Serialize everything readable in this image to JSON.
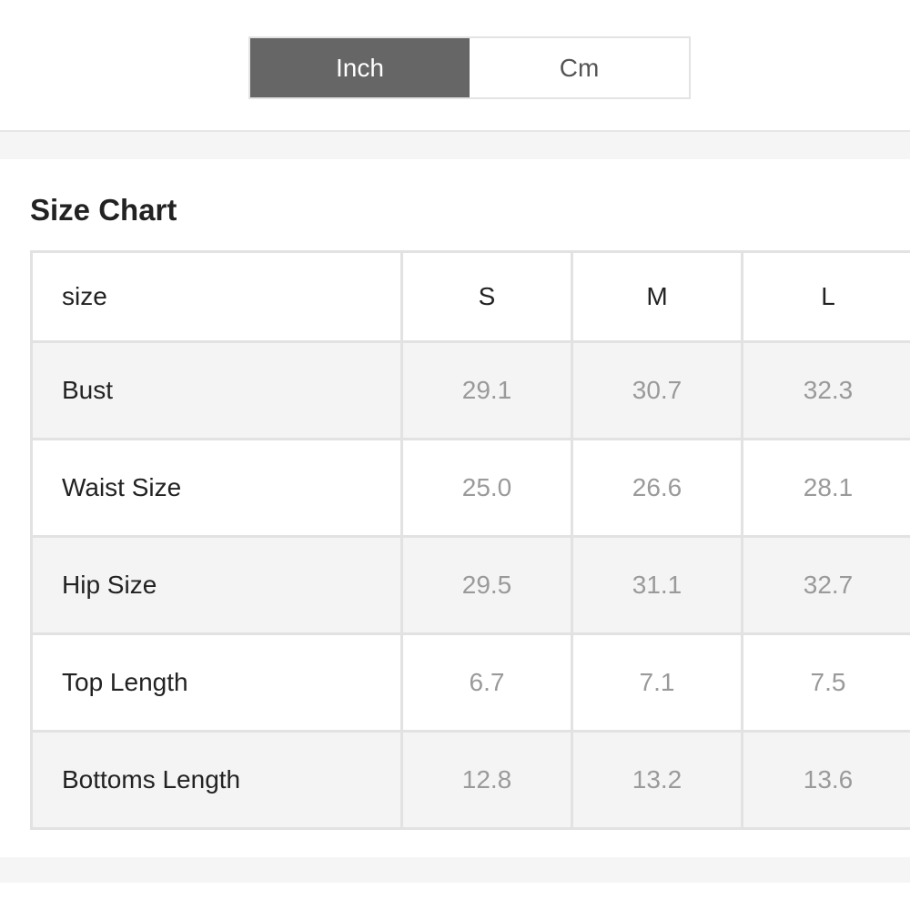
{
  "unit_toggle": {
    "options": [
      "Inch",
      "Cm"
    ],
    "selected": "Inch"
  },
  "title": "Size Chart",
  "table": {
    "columns": [
      "size",
      "S",
      "M",
      "L"
    ],
    "rows": [
      {
        "label": "Bust",
        "values": [
          "29.1",
          "30.7",
          "32.3"
        ]
      },
      {
        "label": "Waist Size",
        "values": [
          "25.0",
          "26.6",
          "28.1"
        ]
      },
      {
        "label": "Hip Size",
        "values": [
          "29.5",
          "31.1",
          "32.7"
        ]
      },
      {
        "label": "Top Length",
        "values": [
          "6.7",
          "7.1",
          "7.5"
        ]
      },
      {
        "label": "Bottoms Length",
        "values": [
          "12.8",
          "13.2",
          "13.6"
        ]
      }
    ]
  },
  "colors": {
    "active_toggle_bg": "#666666",
    "band_bg": "#f5f5f5",
    "shaded_row_bg": "#f4f4f4",
    "value_text": "#9a9a9a"
  }
}
